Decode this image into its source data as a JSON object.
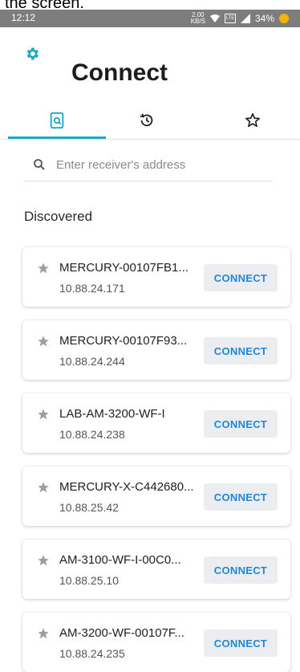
{
  "caption": "the screen.",
  "status_bar": {
    "time": "12:12",
    "speed_top": "2.00",
    "speed_bottom": "KB/S",
    "lte": "LTE",
    "battery": "34%"
  },
  "header": {
    "title": "Connect",
    "settings_icon": "gear-icon"
  },
  "tabs": [
    {
      "icon": "device-search-icon",
      "selected": true
    },
    {
      "icon": "history-icon",
      "selected": false
    },
    {
      "icon": "star-outline-icon",
      "selected": false
    }
  ],
  "search": {
    "placeholder": "Enter receiver's address",
    "value": ""
  },
  "section": {
    "title": "Discovered"
  },
  "devices": [
    {
      "name": "MERCURY-00107FB1...",
      "ip": "10.88.24.171",
      "button": "CONNECT"
    },
    {
      "name": "MERCURY-00107F93...",
      "ip": "10.88.24.244",
      "button": "CONNECT"
    },
    {
      "name": "LAB-AM-3200-WF-I",
      "ip": "10.88.24.238",
      "button": "CONNECT"
    },
    {
      "name": "MERCURY-X-C442680...",
      "ip": "10.88.25.42",
      "button": "CONNECT"
    },
    {
      "name": "AM-3100-WF-I-00C0...",
      "ip": "10.88.25.10",
      "button": "CONNECT"
    },
    {
      "name": "AM-3200-WF-00107F...",
      "ip": "10.88.24.235",
      "button": "CONNECT"
    }
  ],
  "colors": {
    "accent": "#1aa8c2",
    "connect_text": "#1e88d8",
    "button_bg": "#ecedf1",
    "status_bar": "#7d7d7d"
  }
}
